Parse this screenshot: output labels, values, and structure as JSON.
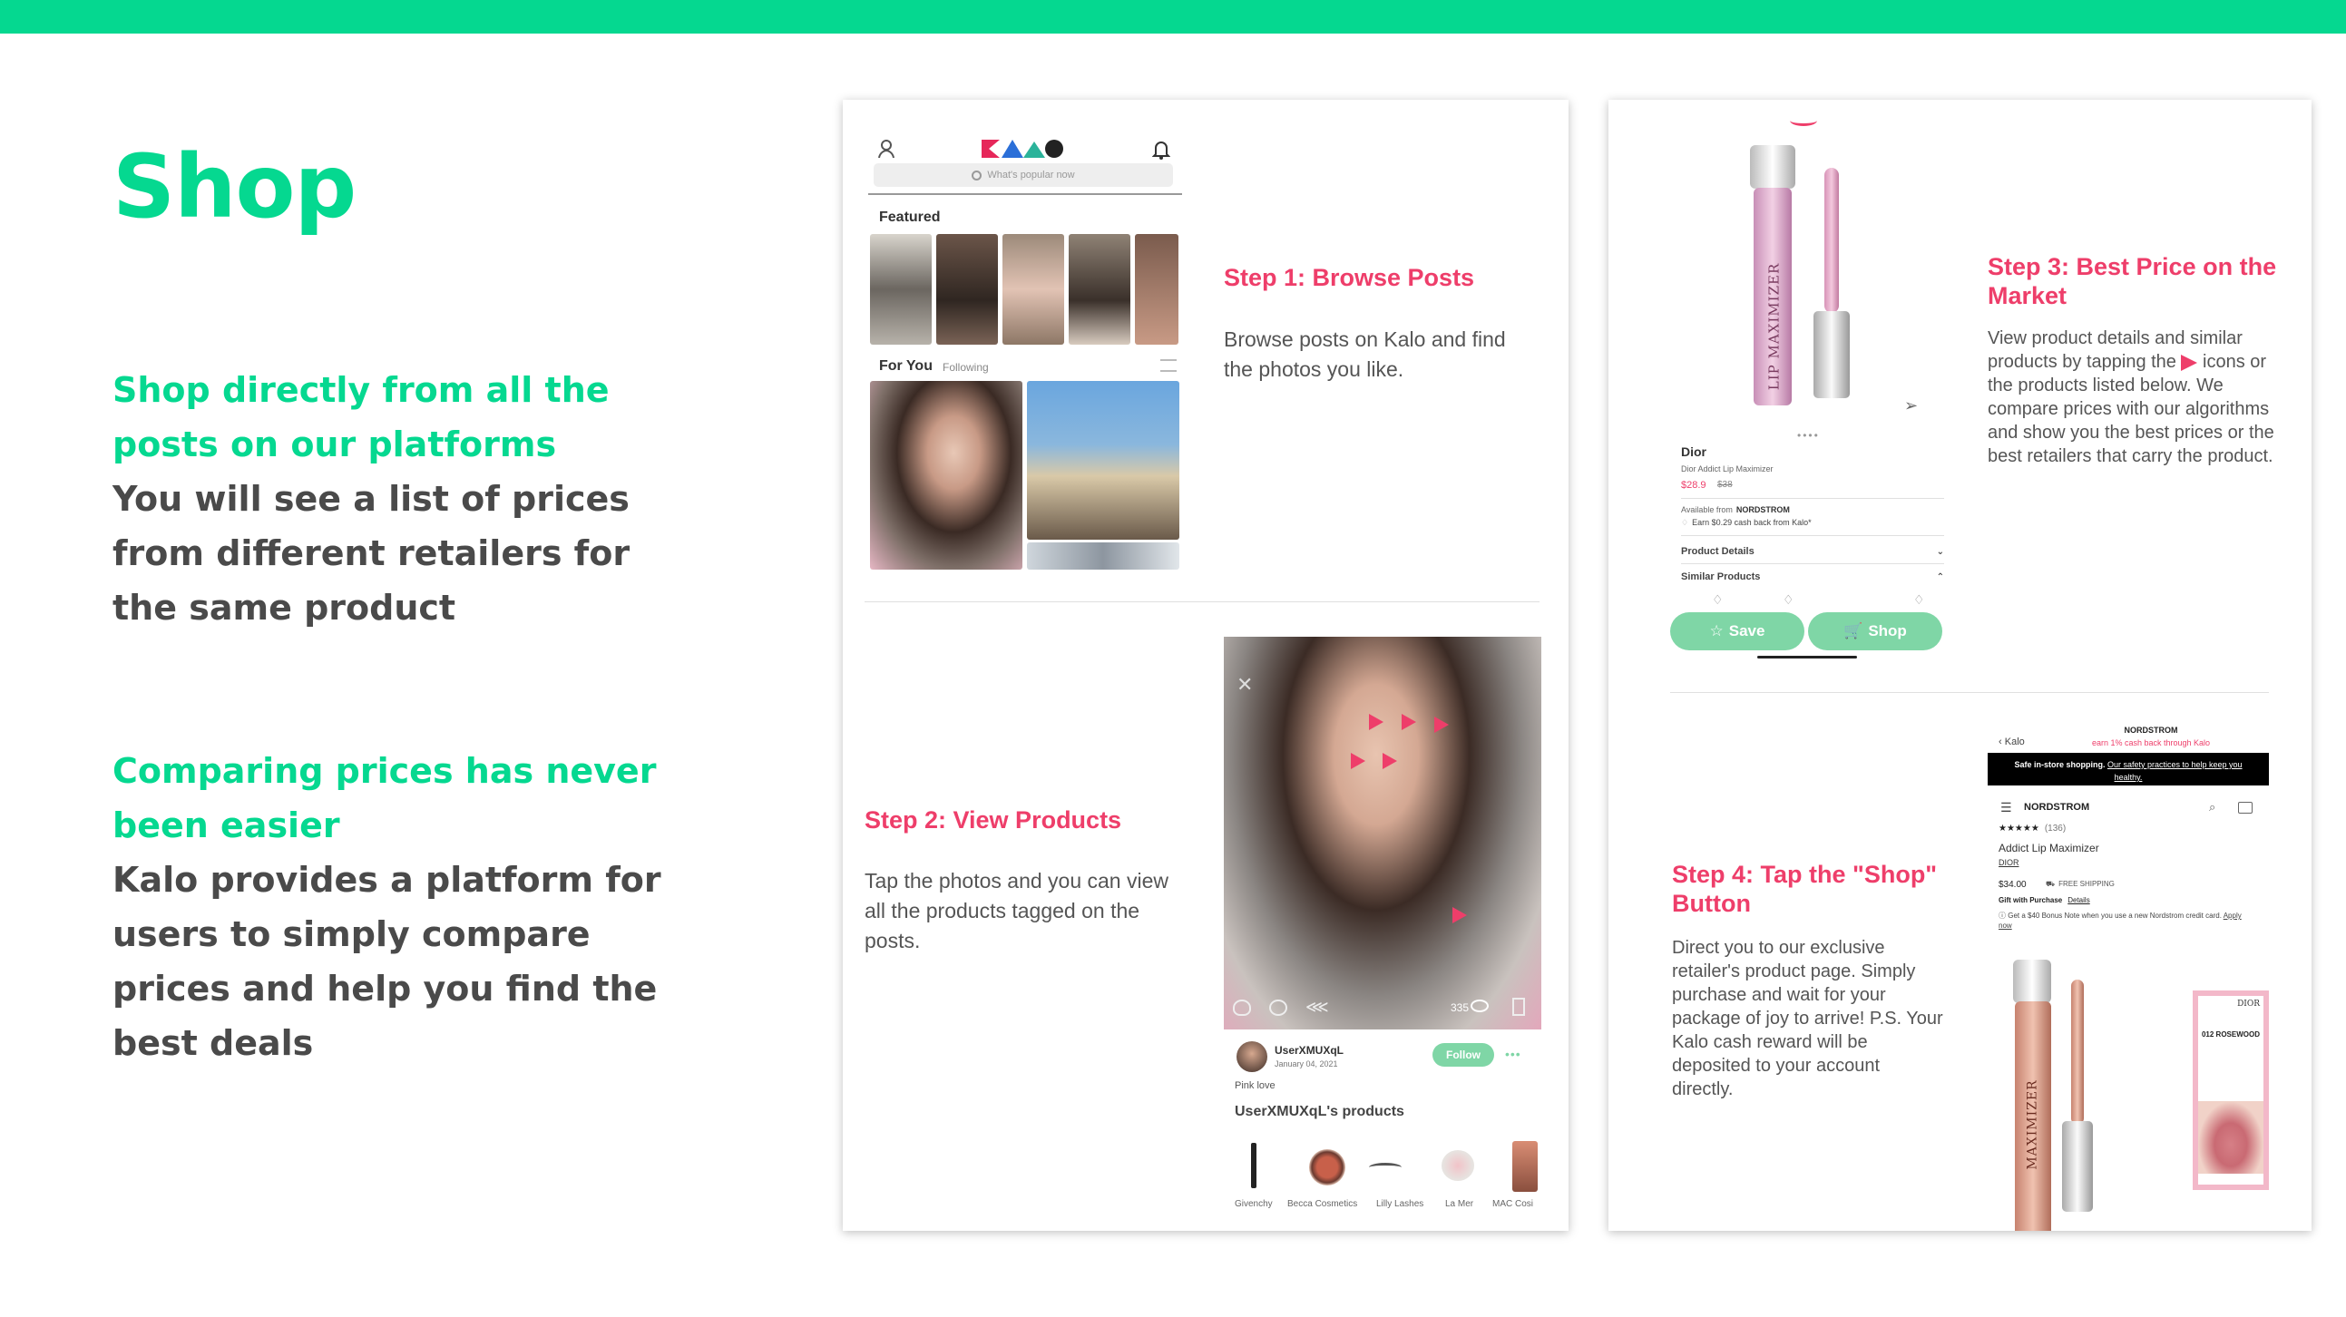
{
  "slide": {
    "title": "Shop",
    "block1": {
      "green_text": "Shop directly from all the posts on our platforms",
      "dark_text": "You will see a list of prices from different retailers for the same product"
    },
    "block2": {
      "green_text": "Comparing prices has never been easier",
      "dark_text": "Kalo provides a platform for users to simply compare prices and help you find the best deals"
    }
  },
  "steps": [
    {
      "title": "Step 1: Browse Posts",
      "text": "Browse posts on Kalo and find the photos you like."
    },
    {
      "title": "Step 2: View Products",
      "text": "Tap the photos and you can view all the products tagged on the posts."
    },
    {
      "title": "Step 3: Best Price on the Market",
      "text_before": "View product details and similar products by tapping the",
      "text_after": "icons or the products listed below. We compare prices with our algorithms and show you the best prices or the best retailers that carry the product."
    },
    {
      "title": "Step 4: Tap the \"Shop\" Button",
      "text": "Direct you to our exclusive retailer's product page. Simply purchase and wait for your package of joy to arrive! P.S. Your Kalo cash reward will be deposited to your account directly."
    }
  ],
  "feed": {
    "search_placeholder": "What's popular now",
    "featured_label": "Featured",
    "for_you_label": "For You",
    "following_label": "Following"
  },
  "post": {
    "username": "UserXMUXqL",
    "date": "January 04, 2021",
    "caption": "Pink love",
    "follow_label": "Follow",
    "view_count": "335",
    "products_title": "UserXMUXqL's products",
    "brands": [
      "Givenchy",
      "Becca Cosmetics",
      "Lilly Lashes",
      "La Mer",
      "MAC Cosi"
    ]
  },
  "product": {
    "brand": "Dior",
    "name": "Dior Addict Lip Maximizer",
    "price": "$28.9",
    "old_price": "$38",
    "available_from": "Available from",
    "retailer": "NORDSTROM",
    "cashback": "Earn $0.29 cash back from Kalo*",
    "details_label": "Product Details",
    "similar_label": "Similar Products",
    "save_label": "Save",
    "shop_label": "Shop",
    "tube_text": "LIP MAXIMIZER"
  },
  "nordstrom": {
    "back_label": "Kalo",
    "header": "NORDSTROM",
    "subheader": "earn 1% cash back through Kalo",
    "banner_bold": "Safe in-store shopping.",
    "banner_link": "Our safety practices to help keep you healthy.",
    "logo": "NORDSTROM",
    "rating_count": "(136)",
    "product_name": "Addict Lip Maximizer",
    "brand_link": "DIOR",
    "price": "$34.00",
    "shipping": "FREE SHIPPING",
    "gift_label": "Gift with Purchase",
    "gift_link": "Details",
    "bonus_note": "Get a $40 Bonus Note when you use a new Nordstrom credit card.",
    "apply_link": "Apply now",
    "shade_brand": "DIOR",
    "shade_name": "012 ROSEWOOD",
    "tube_text": "MAXIMIZER"
  },
  "colors": {
    "brand_green": "#05d890",
    "step_pink": "#ee3e6a",
    "button_green": "#7fd6a6"
  }
}
